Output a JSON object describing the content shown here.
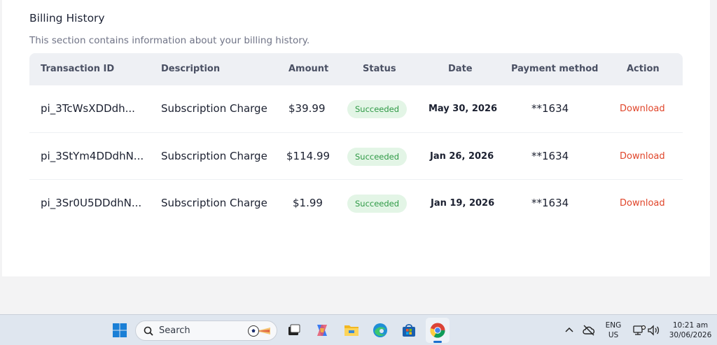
{
  "section": {
    "title": "Billing History",
    "subtitle": "This section contains information about your billing history."
  },
  "table": {
    "headers": [
      "Transaction ID",
      "Description",
      "Amount",
      "Status",
      "Date",
      "Payment method",
      "Action"
    ],
    "rows": [
      {
        "id": "pi_3TcWsXDDdh...",
        "description": "Subscription Charge",
        "amount": "$39.99",
        "status": "Succeeded",
        "date": "May 30, 2026",
        "payment": "**1634",
        "action": "Download"
      },
      {
        "id": "pi_3StYm4DDdhN...",
        "description": "Subscription Charge",
        "amount": "$114.99",
        "status": "Succeeded",
        "date": "Jan 26, 2026",
        "payment": "**1634",
        "action": "Download"
      },
      {
        "id": "pi_3Sr0U5DDdhN...",
        "description": "Subscription Charge",
        "amount": "$1.99",
        "status": "Succeeded",
        "date": "Jan 19, 2026",
        "payment": "**1634",
        "action": "Download"
      }
    ]
  },
  "taskbar": {
    "search_placeholder": "Search",
    "language_line1": "ENG",
    "language_line2": "US",
    "time": "10:21 am",
    "date": "30/06/2026",
    "icons": [
      "windows-start-icon",
      "search-icon",
      "task-view-icon",
      "copilot-icon",
      "file-explorer-icon",
      "edge-icon",
      "store-icon",
      "chrome-icon",
      "chevron-up-icon",
      "cloud-offline-icon",
      "network-icon",
      "volume-icon"
    ]
  },
  "colors": {
    "success_bg": "#e3f5e6",
    "success_text": "#2f9a46",
    "download_link": "#e0452a",
    "header_bg": "#eef0f4"
  }
}
